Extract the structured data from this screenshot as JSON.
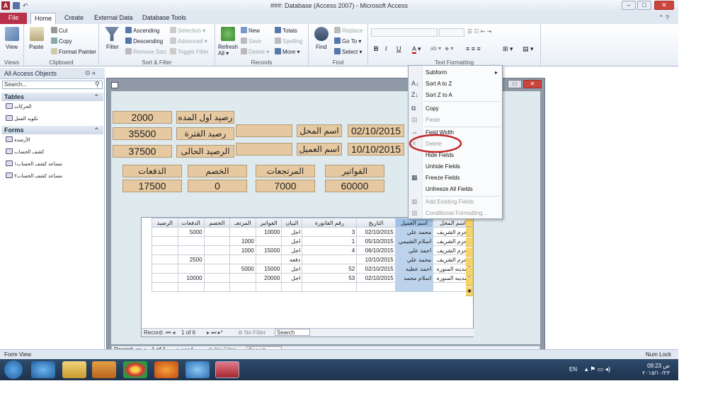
{
  "window": {
    "title": "###: Database (Access 2007) - Microsoft Access"
  },
  "tabs": [
    {
      "label": "File"
    },
    {
      "label": "Home"
    },
    {
      "label": "Create"
    },
    {
      "label": "External Data"
    },
    {
      "label": "Database Tools"
    }
  ],
  "ribbon": {
    "views": {
      "view": "View",
      "group": "Views"
    },
    "clipboard": {
      "paste": "Paste",
      "cut": "Cut",
      "copy": "Copy",
      "format_painter": "Format Painter",
      "group": "Clipboard"
    },
    "sort_filter": {
      "filter": "Filter",
      "ascending": "Ascending",
      "descending": "Descending",
      "remove_sort": "Remove Sort",
      "selection": "Selection",
      "advanced": "Advanced",
      "toggle_filter": "Toggle Filter",
      "group": "Sort & Filter"
    },
    "records": {
      "refresh": "Refresh",
      "refresh2": "All",
      "new": "New",
      "save": "Save",
      "delete": "Delete",
      "totals": "Totals",
      "spelling": "Spelling",
      "more": "More",
      "group": "Records"
    },
    "find": {
      "find": "Find",
      "replace": "Replace",
      "goto": "Go To",
      "select": "Select",
      "group": "Find"
    },
    "text_formatting": {
      "bold": "B",
      "italic": "I",
      "underline": "U",
      "group": "Text Formatting"
    }
  },
  "nav": {
    "title": "All Access Objects",
    "search_placeholder": "Search...",
    "tables_label": "Tables",
    "tables": [
      "الحركات",
      "تكويد العمل"
    ],
    "forms_label": "Forms",
    "forms": [
      "الأرصدة",
      "كشف الحساب",
      "مساعد كشف الحساب١",
      "مساعد كشف الحساب٢"
    ]
  },
  "form": {
    "opening_balance_label": "رصيد اول المده",
    "opening_balance_value": "2000",
    "period_balance_label": "رصيد الفترة",
    "period_balance_value": "35500",
    "current_balance_label": "الرصيد الحالى",
    "current_balance_value": "37500",
    "store_name_label": "اسم المحل",
    "customer_name_label": "اسم العميل",
    "date_from": "02/10/2015",
    "date_to": "10/10/2015",
    "payments_label": "الدفعات",
    "payments_value": "17500",
    "discount_label": "الخصم",
    "discount_value": "0",
    "returns_label": "المرتجعات",
    "returns_value": "7000",
    "invoices_label": "الفواتير",
    "invoices_value": "60000"
  },
  "grid": {
    "headers": [
      "الرصيد",
      "الدفعات",
      "الخصم",
      "المرتجـ",
      "الفواتير",
      "البيان",
      "رقم الفاتورة",
      "التاريخ",
      "اسم العميل",
      "اسم المحل"
    ],
    "rows": [
      [
        "",
        "5000",
        "",
        "",
        "10000",
        "اجل",
        "3",
        "02/10/2015",
        "محمد علي",
        "الحرم الشريف"
      ],
      [
        "",
        "",
        "",
        "1000",
        "",
        "اجل",
        "1",
        "05/10/2015",
        "اسلام الشيمي",
        "الحرم الشريف"
      ],
      [
        "",
        "",
        "",
        "1000",
        "15000",
        "اجل",
        "4",
        "06/10/2015",
        "احمد علي",
        "الحرم الشريف"
      ],
      [
        "",
        "2500",
        "",
        "",
        "",
        "دفعه",
        "",
        "10/10/2015",
        "محمد علي",
        "الحرم الشريف"
      ],
      [
        "",
        "",
        "",
        "5000",
        "15000",
        "اجل",
        "52",
        "02/10/2015",
        "احمد عطيه",
        "المدينه المنوره"
      ],
      [
        "",
        "10000",
        "",
        "",
        "20000",
        "اجل",
        "53",
        "02/10/2015",
        "اسلام محمد",
        "المدينه المنوره"
      ]
    ],
    "record_label": "Record:",
    "record_pos": "1 of 6",
    "no_filter": "No Filter",
    "search": "Search"
  },
  "outer_record": {
    "record_label": "Record:",
    "record_pos": "1 of 1",
    "no_filter": "No Filter",
    "search": "Search"
  },
  "context_menu": [
    {
      "label": "Subform",
      "enabled": true
    },
    {
      "label": "Sort A to Z",
      "enabled": true
    },
    {
      "label": "Sort Z to A",
      "enabled": true
    },
    {
      "label": "Copy",
      "enabled": true
    },
    {
      "label": "Paste",
      "enabled": false
    },
    {
      "label": "Field Width",
      "enabled": true
    },
    {
      "label": "Delete",
      "enabled": false
    },
    {
      "label": "Hide Fields",
      "enabled": true
    },
    {
      "label": "Unhide Fields",
      "enabled": true
    },
    {
      "label": "Freeze Fields",
      "enabled": true
    },
    {
      "label": "Unfreeze All Fields",
      "enabled": true
    },
    {
      "label": "Add Existing Fields",
      "enabled": false
    },
    {
      "label": "Conditional Formatting...",
      "enabled": false
    }
  ],
  "status": {
    "left": "Form View",
    "right": "Num Lock"
  },
  "taskbar": {
    "lang": "EN",
    "time": "09:23 ص",
    "date": "٢٠١٥/١٠/٢٣"
  },
  "colors": {
    "field_fill": "#e6c9a1",
    "form_bg": "#dfeaee",
    "selection": "#bcd3ee",
    "file_tab": "#b8304a",
    "annotation_circle": "#c0282b"
  }
}
